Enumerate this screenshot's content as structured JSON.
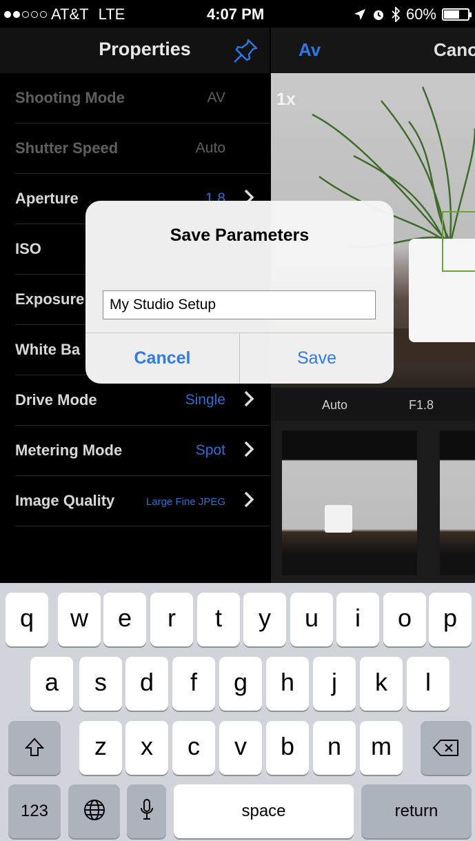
{
  "status_bar": {
    "carrier": "AT&T",
    "network": "LTE",
    "time": "4:07 PM",
    "battery": "60%"
  },
  "properties": {
    "title": "Properties",
    "rows": [
      {
        "label": "Shooting Mode",
        "value": "AV",
        "enabled": false
      },
      {
        "label": "Shutter Speed",
        "value": "Auto",
        "enabled": false
      },
      {
        "label": "Aperture",
        "value": "1.8",
        "enabled": true
      },
      {
        "label": "ISO",
        "value": "",
        "enabled": true
      },
      {
        "label": "Exposure",
        "value": "",
        "enabled": true
      },
      {
        "label": "White Ba",
        "value": "",
        "enabled": true
      },
      {
        "label": "Drive Mode",
        "value": "Single",
        "enabled": true
      },
      {
        "label": "Metering Mode",
        "value": "Spot",
        "enabled": true
      },
      {
        "label": "Image Quality",
        "value": "Large Fine JPEG",
        "enabled": true
      }
    ]
  },
  "camera": {
    "mode": "Av",
    "brand_partial": "Cano",
    "zoom": "1x",
    "shutter": "Auto",
    "aperture": "F1.8"
  },
  "dialog": {
    "title": "Save Parameters",
    "input_value": "My Studio Setup",
    "cancel_label": "Cancel",
    "save_label": "Save"
  },
  "keyboard": {
    "row1": [
      "q",
      "w",
      "e",
      "r",
      "t",
      "y",
      "u",
      "i",
      "o",
      "p"
    ],
    "row2": [
      "a",
      "s",
      "d",
      "f",
      "g",
      "h",
      "j",
      "k",
      "l"
    ],
    "row3": [
      "z",
      "x",
      "c",
      "v",
      "b",
      "n",
      "m"
    ],
    "numbers_label": "123",
    "space_label": "space",
    "return_label": "return"
  },
  "colors": {
    "accent": "#2f78e6",
    "focus": "#6aa33a"
  }
}
